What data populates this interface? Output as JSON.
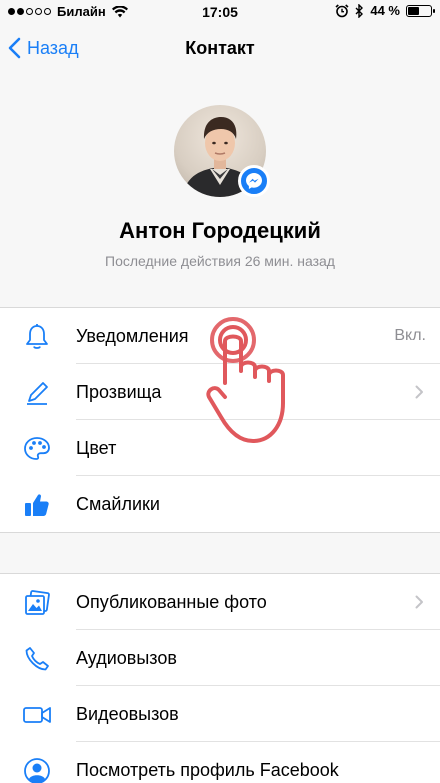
{
  "status_bar": {
    "carrier": "Билайн",
    "time": "17:05",
    "battery": "44 %",
    "battery_level": 0.44
  },
  "nav": {
    "back_label": "Назад",
    "title": "Контакт"
  },
  "profile": {
    "name": "Антон Городецкий",
    "last_seen": "Последние действия 26 мин. назад"
  },
  "settings_group": [
    {
      "label": "Уведомления",
      "value": "Вкл.",
      "icon": "bell-icon"
    },
    {
      "label": "Прозвища",
      "icon": "pencil-icon"
    },
    {
      "label": "Цвет",
      "icon": "palette-icon"
    },
    {
      "label": "Смайлики",
      "icon": "thumbs-up-icon"
    }
  ],
  "media_group": [
    {
      "label": "Опубликованные фото",
      "icon": "photos-icon"
    },
    {
      "label": "Аудиовызов",
      "icon": "phone-icon"
    },
    {
      "label": "Видеовызов",
      "icon": "video-camera-icon"
    },
    {
      "label": "Посмотреть профиль Facebook",
      "icon": "profile-icon"
    }
  ],
  "colors": {
    "accent": "#1a7ff7",
    "tap_hand": "#e0585c"
  }
}
